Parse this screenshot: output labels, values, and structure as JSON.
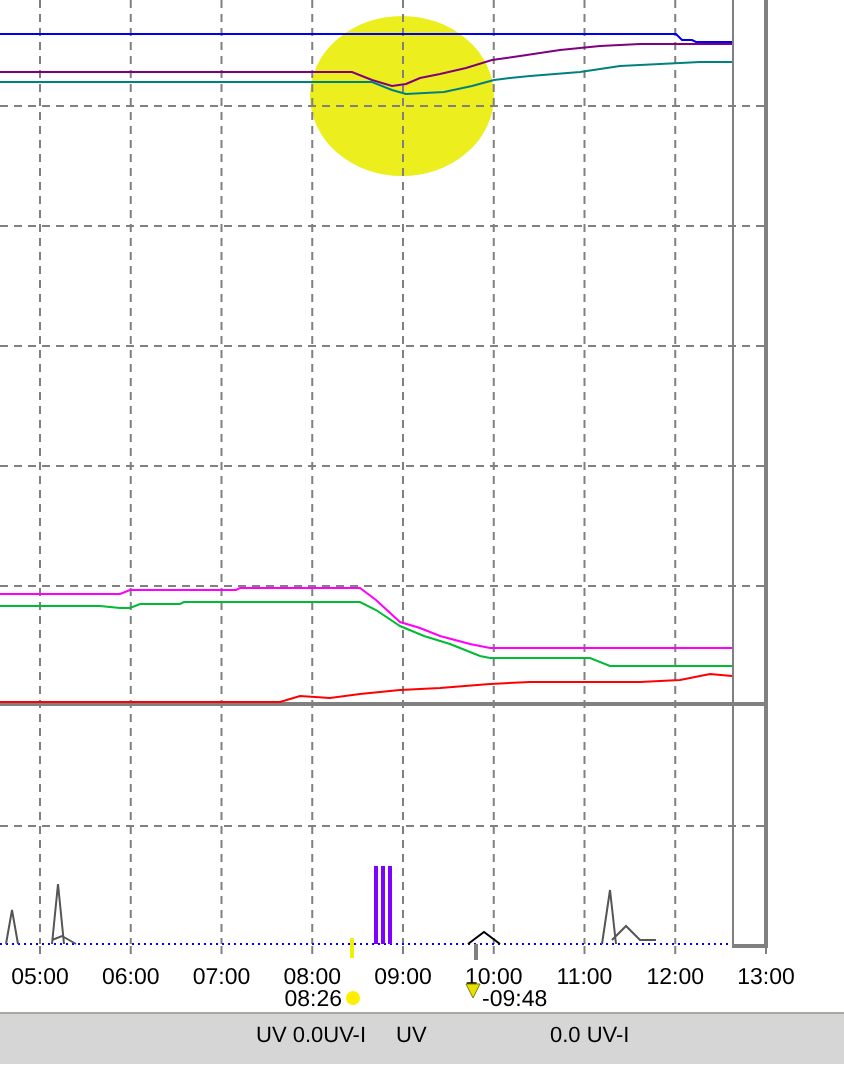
{
  "time_axis": {
    "ticks": [
      "05:00",
      "06:00",
      "07:00",
      "08:00",
      "09:00",
      "10:00",
      "11:00",
      "12:00",
      "13:00"
    ]
  },
  "sun": {
    "sunrise": "08:26",
    "sunset": "-09:48"
  },
  "status_bar": {
    "items": [
      "UV 0.0UV-I",
      "UV",
      "0.0 UV-I"
    ]
  }
}
